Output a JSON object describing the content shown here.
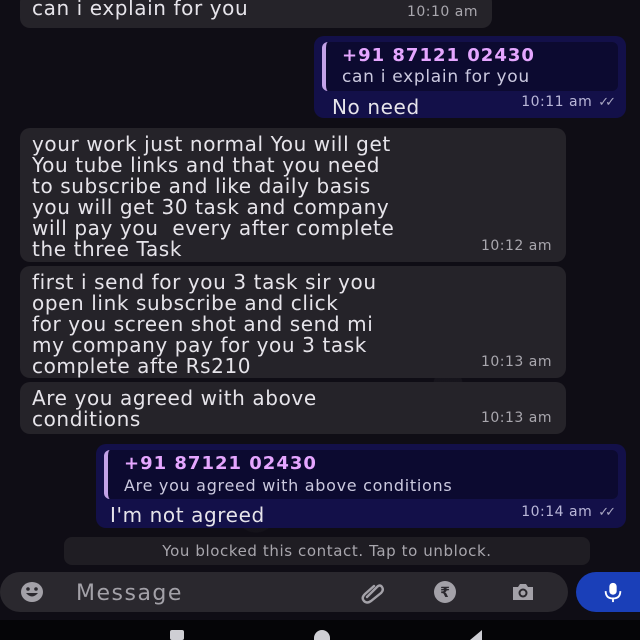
{
  "messages": [
    {
      "text": "can i explain for you",
      "time": "10:10 am"
    },
    {
      "quote_name": "+91 87121 02430",
      "quote_text": "can i explain for you",
      "text": "No need",
      "time": "10:11 am"
    },
    {
      "text": "your work just normal You will get\nYou tube links and that you need\nto subscribe and like daily basis\nyou will get 30 task and company\nwill pay you  every after complete\nthe three Task",
      "time": "10:12 am"
    },
    {
      "text": "first i send for you 3 task sir you\nopen link subscribe and click\nfor you screen shot and send mi\nmy company pay for you 3 task\ncomplete afte Rs210",
      "time": "10:13 am"
    },
    {
      "text": "Are you agreed with above\nconditions",
      "time": "10:13 am"
    },
    {
      "quote_name": "+91 87121 02430",
      "quote_text": "Are you agreed with above conditions",
      "text": "I'm not agreed",
      "time": "10:14 am"
    }
  ],
  "system_note": "You blocked this contact. Tap to unblock.",
  "composer": {
    "placeholder": "Message"
  },
  "icons": {
    "emoji": "emoji-icon",
    "attach": "paperclip-icon",
    "payment": "rupee-icon",
    "camera": "camera-icon",
    "mic": "mic-icon",
    "read_receipt": "double-check-icon"
  },
  "colors": {
    "incoming_bubble": "#252329",
    "outgoing_bubble": "#131049",
    "quote_accent": "#e5a6ff",
    "mic_button": "#1a3fb8"
  }
}
